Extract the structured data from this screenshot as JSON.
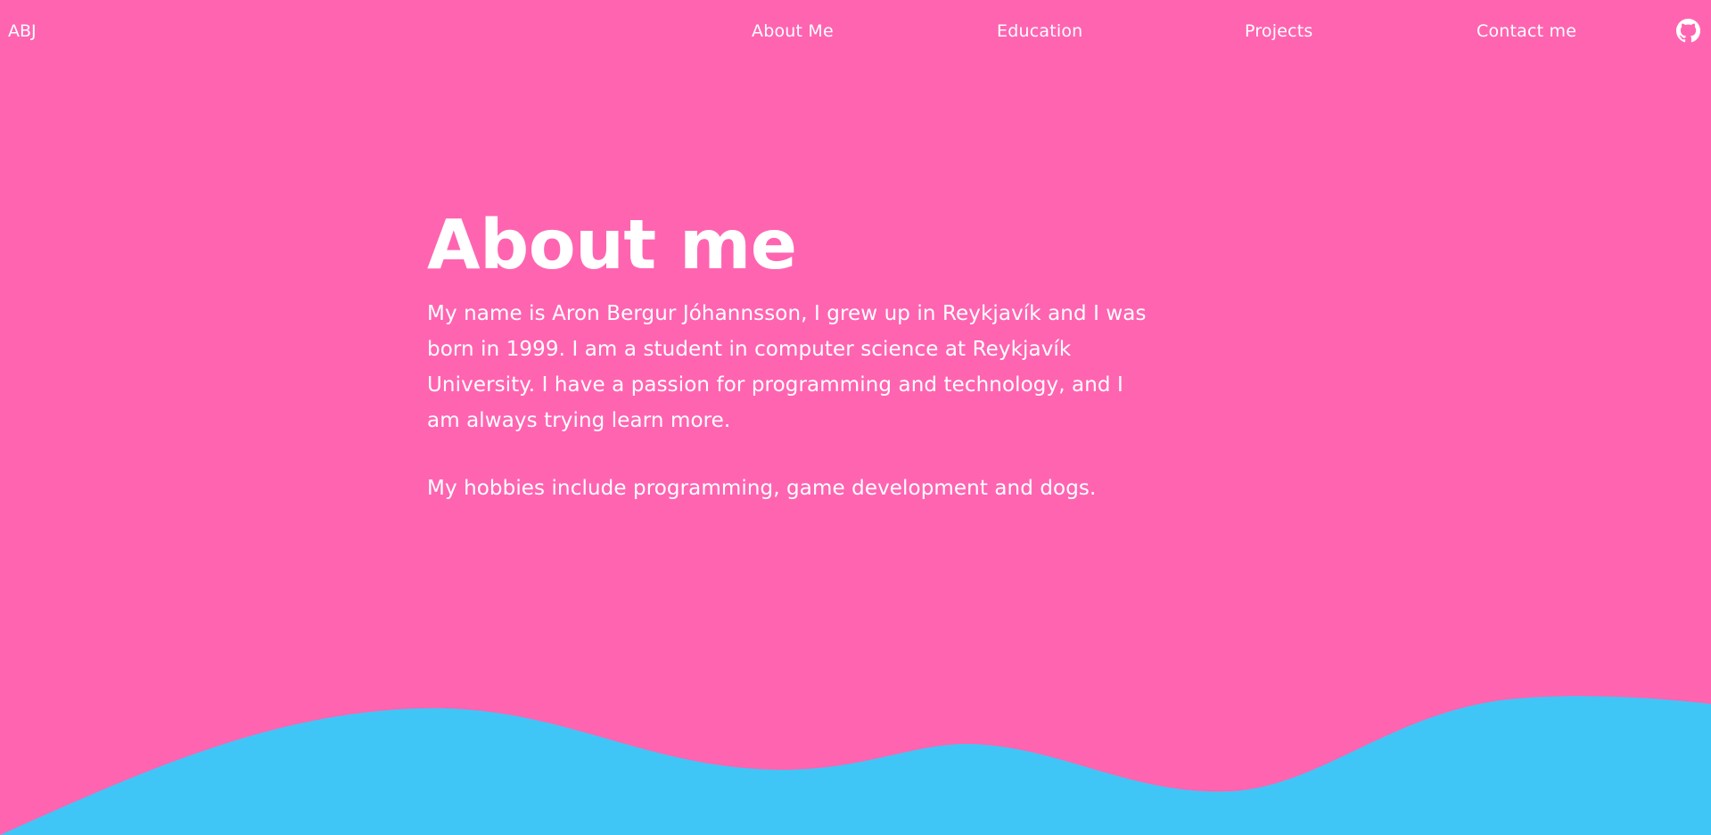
{
  "nav": {
    "logo": "ABJ",
    "links": [
      {
        "label": "About Me"
      },
      {
        "label": "Education"
      },
      {
        "label": "Projects"
      },
      {
        "label": "Contact me"
      }
    ],
    "github_icon": "github-icon"
  },
  "main": {
    "heading": "About me",
    "paragraphs": [
      "My name is Aron Bergur Jóhannsson, I grew up in Reykjavík and I was born in 1999. I am a student in computer science at Reykjavík University. I have a passion for programming and technology, and I am always trying learn more.",
      "My hobbies include programming, game development and dogs."
    ]
  },
  "colors": {
    "background": "#ff64b1",
    "wave": "#3fc6f7",
    "text": "#ffffff"
  }
}
